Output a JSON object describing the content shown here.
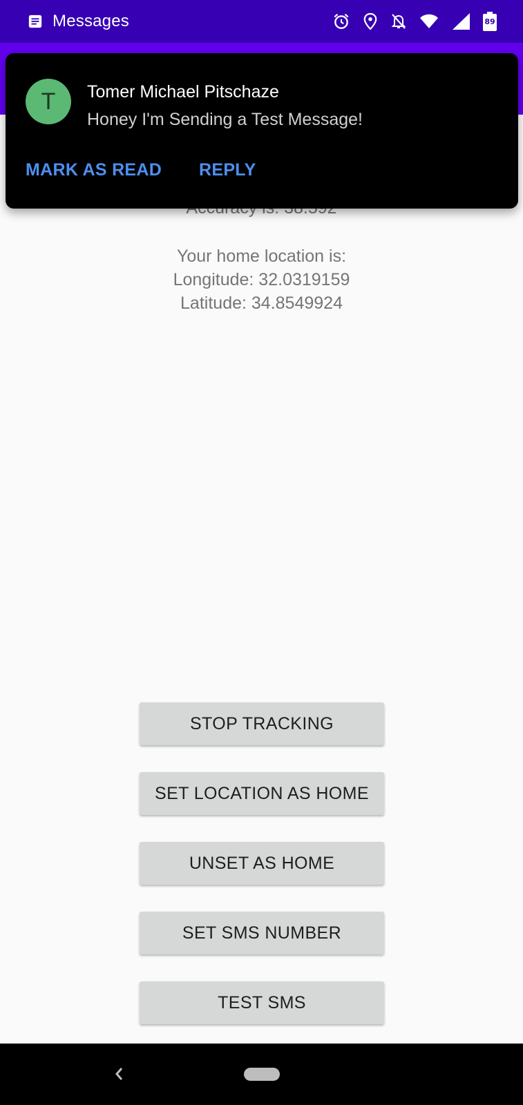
{
  "status_bar": {
    "app_name": "Messages",
    "battery_level": "89",
    "icons": [
      "messages-icon",
      "alarm-icon",
      "location-icon",
      "notifications-off-icon",
      "wifi-icon",
      "signal-icon",
      "battery-icon"
    ]
  },
  "notification": {
    "avatar_letter": "T",
    "sender": "Tomer Michael Pitschaze",
    "message": "Honey I'm Sending a Test Message!",
    "actions": {
      "mark_read": "MARK AS READ",
      "reply": "REPLY"
    }
  },
  "location": {
    "accuracy": "Accuracy is: 38.592",
    "home_label": "Your home location is:",
    "longitude": "Longitude: 32.0319159",
    "latitude": "Latitude: 34.8549924"
  },
  "buttons": {
    "stop_tracking": "STOP TRACKING",
    "set_home": "SET LOCATION AS HOME",
    "unset_home": "UNSET AS HOME",
    "set_sms": "SET SMS NUMBER",
    "test_sms": "TEST SMS"
  },
  "colors": {
    "status_bar": "#3700b3",
    "app_bar": "#6200ee",
    "avatar": "#5bb974",
    "notification_action": "#4d8ff0",
    "button_bg": "#d6d7d7"
  }
}
